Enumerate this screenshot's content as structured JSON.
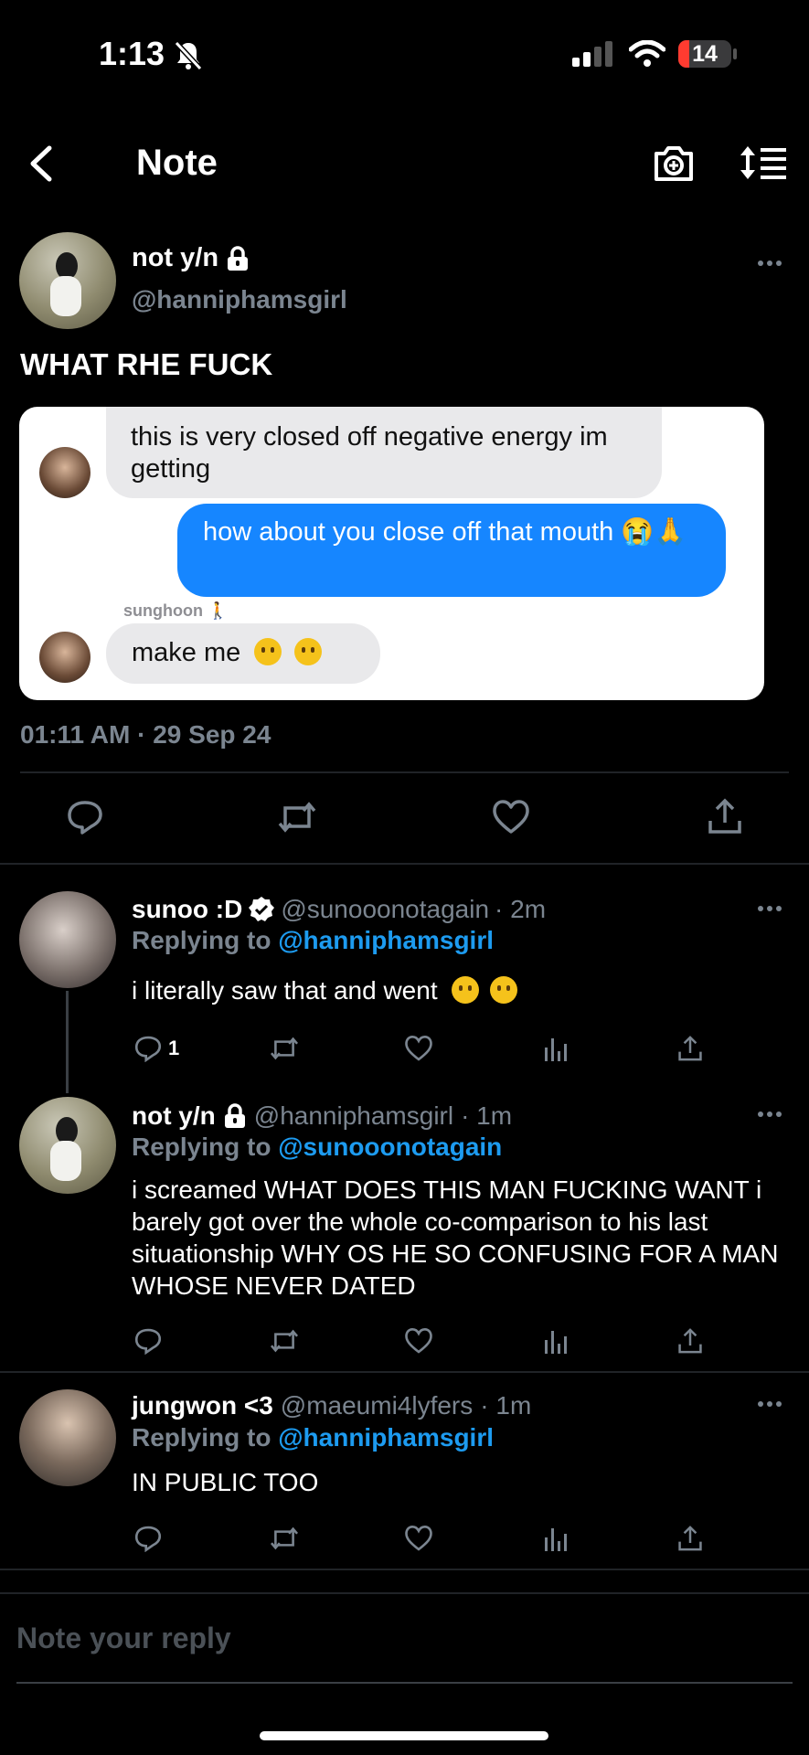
{
  "status_bar": {
    "time": "1:13",
    "battery": "14"
  },
  "header": {
    "title": "Note"
  },
  "note": {
    "display_name": "not y/n",
    "handle": "@hanniphamsgirl",
    "text": "WHAT RHE FUCK",
    "timestamp": "01:11 AM · 29 Sep 24",
    "chat": {
      "msg1": "this is very closed off negative energy im getting",
      "msg2": "how about you close off that mouth 😭🙏",
      "sender_name": "sunghoon 🚶",
      "msg3": "make me"
    }
  },
  "replies": [
    {
      "display_name": "sunoo :D",
      "handle": "@sunooonotagain",
      "time": "· 2m",
      "replying_label": "Replying to",
      "replying_to": "@hanniphamsgirl",
      "text": "i literally saw that and went",
      "reply_count": "1"
    },
    {
      "display_name": "not y/n",
      "handle": "@hanniphamsgirl",
      "time": "· 1m",
      "replying_label": "Replying to",
      "replying_to": "@sunooonotagain",
      "text": "i screamed WHAT DOES THIS MAN FUCKING WANT i barely got over the whole co-comparison to his last situationship WHY OS HE SO CONFUSING FOR A MAN WHOSE NEVER DATED"
    },
    {
      "display_name": "jungwon <3",
      "handle": "@maeumi4lyfers",
      "time": "· 1m",
      "replying_label": "Replying to",
      "replying_to": "@hanniphamsgirl",
      "text": "IN PUBLIC TOO"
    }
  ],
  "reply_box": {
    "placeholder": "Note your reply"
  },
  "colors": {
    "accent": "#1d9bf0",
    "imessage_blue": "#1686ff",
    "muted": "#7b8590"
  }
}
